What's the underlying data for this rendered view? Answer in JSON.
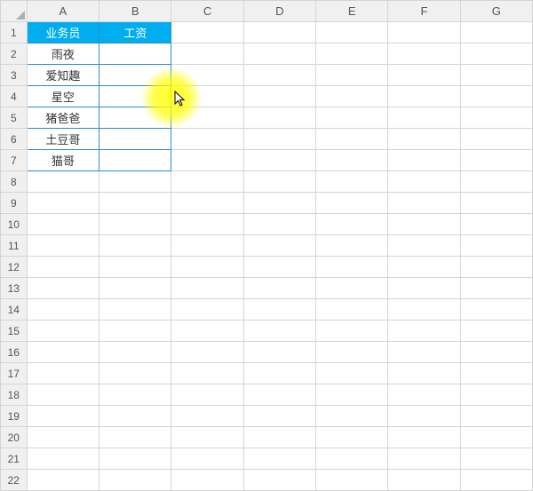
{
  "columns": [
    "A",
    "B",
    "C",
    "D",
    "E",
    "F",
    "G"
  ],
  "rows": [
    "1",
    "2",
    "3",
    "4",
    "5",
    "6",
    "7",
    "8",
    "9",
    "10",
    "11",
    "12",
    "13",
    "14",
    "15",
    "16",
    "17",
    "18",
    "19",
    "20",
    "21",
    "22"
  ],
  "header": {
    "A": "业务员",
    "B": "工资"
  },
  "names": [
    "雨夜",
    "爱知趣",
    "星空",
    "猪爸爸",
    "土豆哥",
    "猫哥"
  ],
  "cursor_icon": "cursor-arrow",
  "highlight_icon": "highlight-circle"
}
